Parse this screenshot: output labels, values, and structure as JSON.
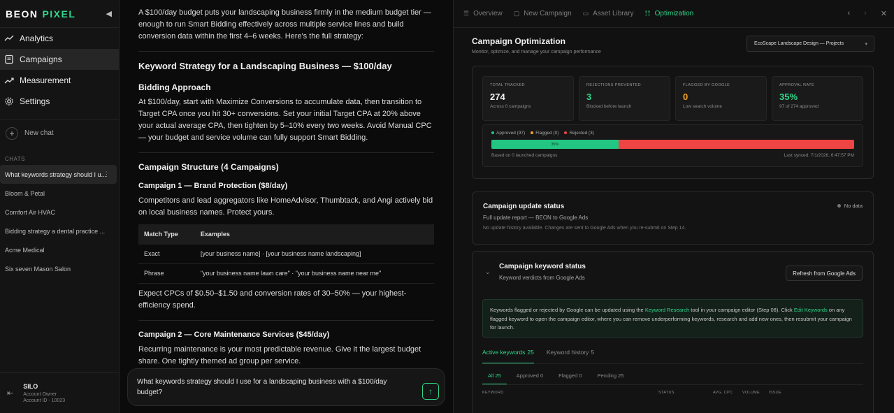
{
  "brand": {
    "part1": "BEON",
    "part2": "PIXEL"
  },
  "nav": [
    {
      "label": "Analytics"
    },
    {
      "label": "Campaigns"
    },
    {
      "label": "Measurement"
    },
    {
      "label": "Settings"
    }
  ],
  "new_chat_label": "New chat",
  "chats_label": "CHATS",
  "chats": [
    "What keywords strategy should I u...",
    "Bloom & Petal",
    "Comfort Air HVAC",
    "Bidding strategy a dental practice ...",
    "Acme Medical",
    "Six seven Mason Salon"
  ],
  "user": {
    "name": "SILO",
    "role": "Account Owner",
    "id": "Account ID - 10023"
  },
  "chat": {
    "intro": "A $100/day budget puts your landscaping business firmly in the medium budget tier — enough to run Smart Bidding effectively across multiple service lines and build conversion data within the first 4–6 weeks. Here's the full strategy:",
    "title": "Keyword Strategy for a Landscaping Business — $100/day",
    "bidding_title": "Bidding Approach",
    "bidding_text": "At $100/day, start with Maximize Conversions to accumulate data, then transition to Target CPA once you hit 30+ conversions. Set your initial Target CPA at 20% above your actual average CPA, then tighten by 5–10% every two weeks. Avoid Manual CPC — your budget and service volume can fully support Smart Bidding.",
    "structure_title": "Campaign Structure (4 Campaigns)",
    "c1_title": "Campaign 1 — Brand Protection ($8/day)",
    "c1_text": "Competitors and lead aggregators like HomeAdvisor, Thumbtack, and Angi actively bid on local business names. Protect yours.",
    "table": {
      "headers": [
        "Match Type",
        "Examples"
      ],
      "rows": [
        [
          "Exact",
          "[your business name] · [your business name landscaping]"
        ],
        [
          "Phrase",
          "\"your business name lawn care\" · \"your business name near me\""
        ]
      ]
    },
    "c1_after": "Expect CPCs of $0.50–$1.50 and conversion rates of 30–50% — your highest-efficiency spend.",
    "c2_title": "Campaign 2 — Core Maintenance Services ($45/day)",
    "c2_text": "Recurring maintenance is your most predictable revenue. Give it the largest budget share. One tightly themed ad group per service.",
    "composer_text": "What keywords strategy should I use for a landscaping business with a $100/day budget?"
  },
  "tabs": [
    {
      "label": "Overview",
      "icon": "list-icon"
    },
    {
      "label": "New Campaign",
      "icon": "doc-icon"
    },
    {
      "label": "Asset Library",
      "icon": "folder-icon"
    },
    {
      "label": "Optimization",
      "icon": "sliders-icon"
    }
  ],
  "optimization": {
    "title": "Campaign Optimization",
    "subtitle": "Monitor, optimize, and manage your campaign performance",
    "project": "EcoScape Landscape Design — Projects",
    "cards": [
      {
        "label": "TOTAL TRACKED",
        "value": "274",
        "sub": "Across 0 campaigns",
        "color": "#f2f2f2"
      },
      {
        "label": "REJECTIONS PREVENTED",
        "value": "3",
        "sub": "Blocked before launch",
        "color": "#2fd68a"
      },
      {
        "label": "FLAGGED BY GOOGLE",
        "value": "0",
        "sub": "Low search volume",
        "color": "#f5a524"
      },
      {
        "label": "APPROVAL RATE",
        "value": "35%",
        "sub": "97 of 274 approved",
        "color": "#2fd68a"
      }
    ],
    "legend": [
      {
        "label": "Approved (97)",
        "color": "#22c581"
      },
      {
        "label": "Flagged (0)",
        "color": "#f5a524"
      },
      {
        "label": "Rejected (3)",
        "color": "#ef4444"
      }
    ],
    "approval_pct": 35,
    "approval_pct_label": "35%",
    "based_on": "Based on 0 launched campaigns",
    "last_synced": "Last synced: 7/1/2026, 6:47:57 PM"
  },
  "update_status": {
    "title": "Campaign update status",
    "subtitle": "Full update report — BEON to Google Ads",
    "note": "No update history available. Changes are sent to Google Ads when you re-submit on Step 14.",
    "badge": "No data"
  },
  "keyword_status": {
    "title": "Campaign keyword status",
    "subtitle": "Keyword verdicts from Google Ads",
    "refresh": "Refresh from Google Ads",
    "info_1": "Keywords flagged or rejected by Google can be updated using the ",
    "info_link1": "Keyword Research",
    "info_2": " tool in your campaign editor (Step 08). Click ",
    "info_link2": "Edit Keywords",
    "info_3": " on any flagged keyword to open the campaign editor, where you can remove underperforming keywords, research and add new ones, then resubmit your campaign for launch.",
    "tabs": [
      {
        "label": "Active keywords",
        "count": "25"
      },
      {
        "label": "Keyword history",
        "count": "5"
      }
    ],
    "filters": [
      "All 25",
      "Approved 0",
      "Flagged 0",
      "Pending 25"
    ],
    "columns": [
      "KEYWORD",
      "STATUS",
      "AVG. CPC",
      "VOLUME",
      "ISSUE"
    ]
  }
}
